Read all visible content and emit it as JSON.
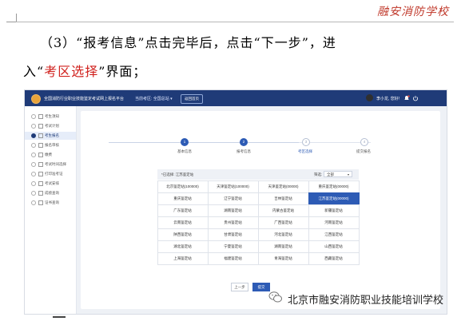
{
  "doc": {
    "header_brand": "融安消防学校",
    "line1": "（3）“报考信息”点击完毕后，点击“下一步”，进",
    "line2_prefix": "入“",
    "line2_highlight": "考区选择",
    "line2_suffix": "”界面；",
    "footer_text": "北京市融安消防职业技能培训学校"
  },
  "app": {
    "title": "全国消防行业职业技能鉴定考试网上报名平台",
    "region_label": "当前考区: 全国总站 ▾",
    "back_button": "返回首页",
    "user_name": "李小龙, 您好!",
    "sidebar": [
      {
        "label": "考生须知",
        "active": false
      },
      {
        "label": "考试计划",
        "active": false
      },
      {
        "label": "考生报名",
        "active": true
      },
      {
        "label": "报名审核",
        "active": false
      },
      {
        "label": "缴费",
        "active": false
      },
      {
        "label": "考试时间选择",
        "active": false
      },
      {
        "label": "打印准考证",
        "active": false
      },
      {
        "label": "考试安排",
        "active": false
      },
      {
        "label": "成绩查询",
        "active": false
      },
      {
        "label": "证书查询",
        "active": false
      }
    ],
    "steps": [
      {
        "num": "1",
        "label": "基本信息",
        "state": "done"
      },
      {
        "num": "2",
        "label": "报考信息",
        "state": "done"
      },
      {
        "num": "3",
        "label": "考区选择",
        "state": "todo"
      },
      {
        "num": "4",
        "label": "提交报名",
        "state": "todo"
      }
    ],
    "current_region": "*已选择: 江苏鉴定站",
    "filter_label": "筛选:",
    "filter_value": "全部",
    "regions": [
      [
        "北京鉴定站(100000)",
        "天津鉴定站(100000)",
        "天津鉴定站(00000)",
        "重庆鉴定站(00000)"
      ],
      [
        "重庆鉴定站",
        "辽宁鉴定站",
        "吉林鉴定站",
        "江苏鉴定站(00000)"
      ],
      [
        "广东鉴定站",
        "湖南鉴定站",
        "内蒙古鉴定站",
        "新疆鉴定站"
      ],
      [
        "云南鉴定站",
        "贵州鉴定站",
        "广西鉴定站",
        "河南鉴定站"
      ],
      [
        "陕西鉴定站",
        "甘肃鉴定站",
        "河北鉴定站",
        "江西鉴定站"
      ],
      [
        "湖北鉴定站",
        "宁夏鉴定站",
        "湖南鉴定站",
        "山西鉴定站"
      ],
      [
        "上海鉴定站",
        "福建鉴定站",
        "青海鉴定站",
        "西藏鉴定站"
      ]
    ],
    "selected_region": "江苏鉴定站(00000)",
    "prev_button": "上一步",
    "next_button": "提交"
  },
  "colors": {
    "header_bg": "#1f3b78",
    "accent": "#2d5bb5",
    "highlight_text": "#d0201c"
  }
}
